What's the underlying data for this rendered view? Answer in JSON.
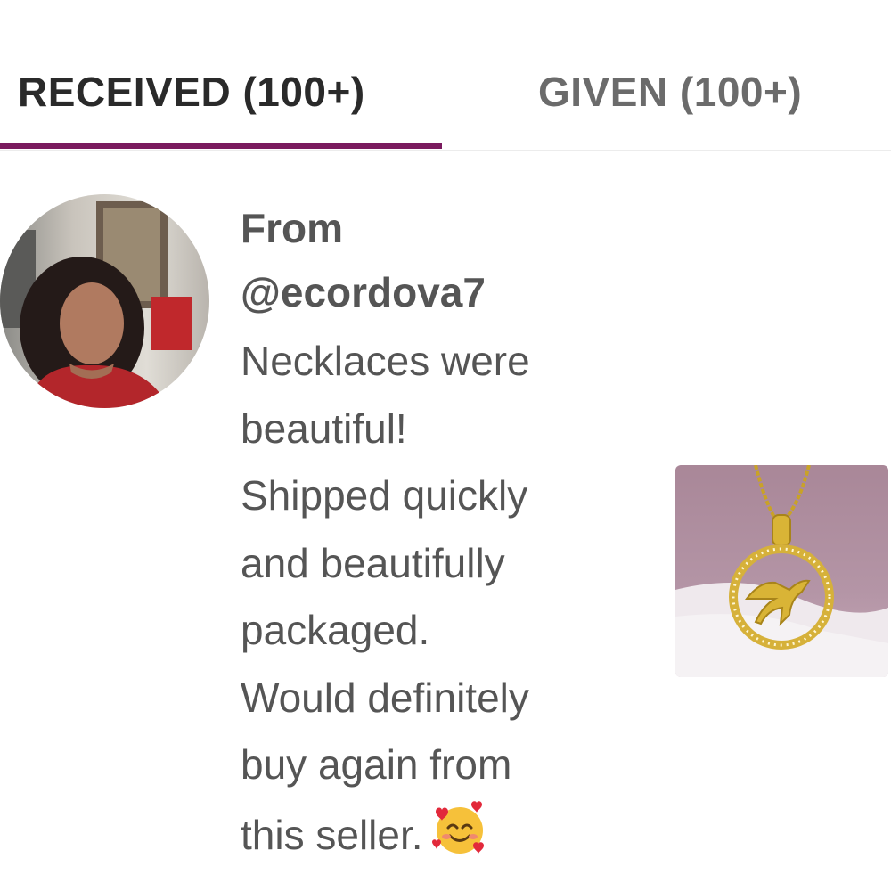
{
  "tabs": [
    {
      "label": "RECEIVED (100+)",
      "active": true
    },
    {
      "label": "GIVEN (100+)",
      "active": false
    }
  ],
  "review": {
    "from_label": "From",
    "handle": "@ecordova7",
    "comment": "Necklaces were\nbeautiful!\nShipped quickly\nand beautifully\npackaged.\nWould definitely\nbuy again from\nthis seller.",
    "emoji": "smiling-face-with-hearts-icon"
  },
  "colors": {
    "accent": "#7a1a5e",
    "text": "#555555",
    "active_tab_text": "#2a2a2a",
    "inactive_tab_text": "#6b6b6b"
  }
}
